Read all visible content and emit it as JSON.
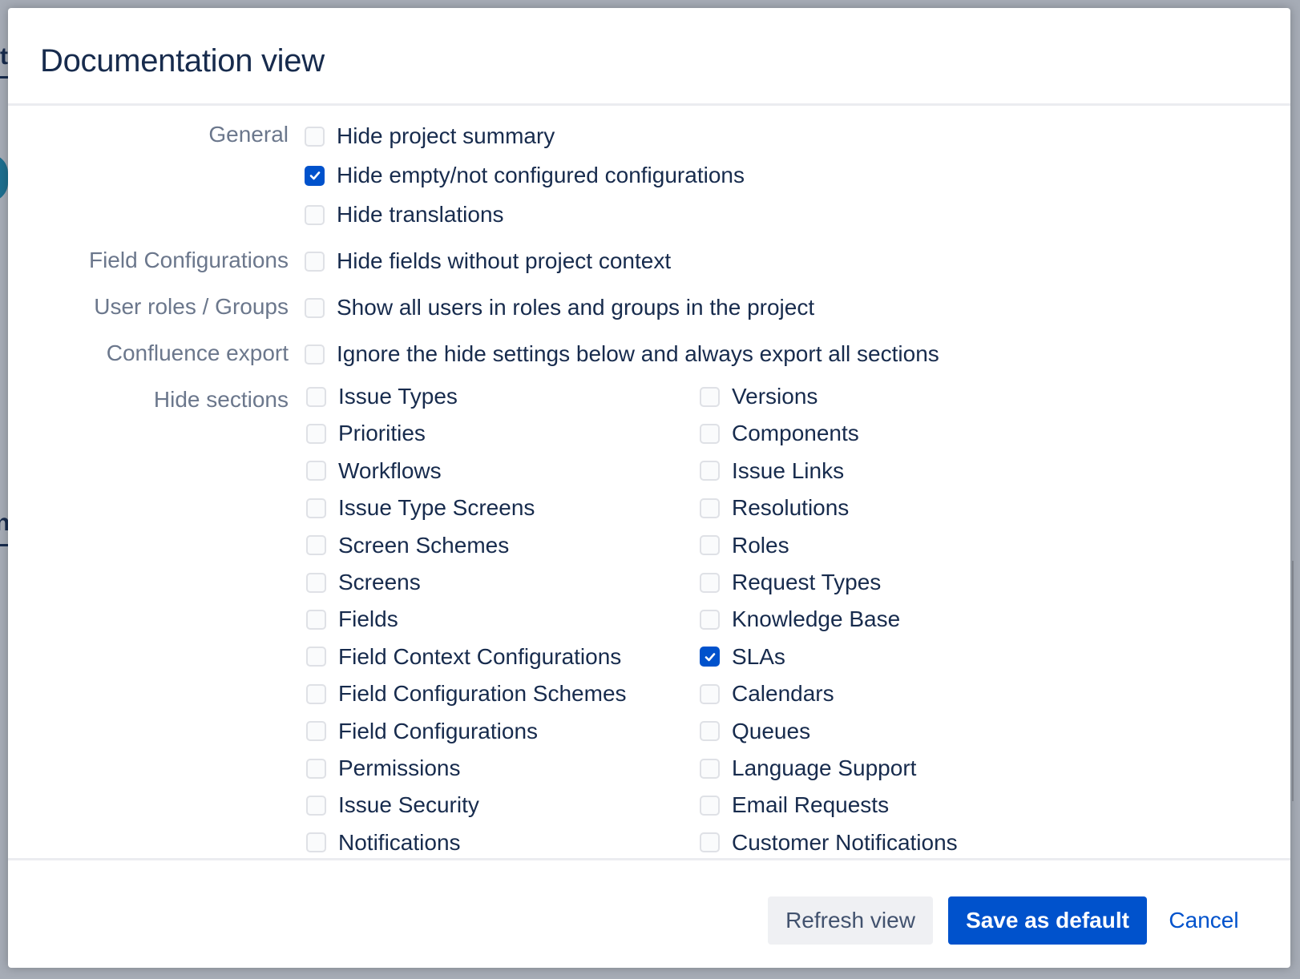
{
  "background": {
    "fragments": [
      "t",
      "n"
    ]
  },
  "dialog": {
    "title": "Documentation view",
    "general": {
      "label": "General",
      "options": [
        {
          "label": "Hide project summary",
          "checked": false
        },
        {
          "label": "Hide empty/not configured configurations",
          "checked": true
        },
        {
          "label": "Hide translations",
          "checked": false
        }
      ]
    },
    "field_configurations": {
      "label": "Field Configurations",
      "option": {
        "label": "Hide fields without project context",
        "checked": false
      }
    },
    "user_roles": {
      "label": "User roles / Groups",
      "option": {
        "label": "Show all users in roles and groups in the project",
        "checked": false
      }
    },
    "confluence_export": {
      "label": "Confluence export",
      "option": {
        "label": "Ignore the hide settings below and always export all sections",
        "checked": false
      }
    },
    "hide_sections": {
      "label": "Hide sections",
      "left": [
        {
          "label": "Issue Types",
          "checked": false
        },
        {
          "label": "Priorities",
          "checked": false
        },
        {
          "label": "Workflows",
          "checked": false
        },
        {
          "label": "Issue Type Screens",
          "checked": false
        },
        {
          "label": "Screen Schemes",
          "checked": false
        },
        {
          "label": "Screens",
          "checked": false
        },
        {
          "label": "Fields",
          "checked": false
        },
        {
          "label": "Field Context Configurations",
          "checked": false
        },
        {
          "label": "Field Configuration Schemes",
          "checked": false
        },
        {
          "label": "Field Configurations",
          "checked": false
        },
        {
          "label": "Permissions",
          "checked": false
        },
        {
          "label": "Issue Security",
          "checked": false
        },
        {
          "label": "Notifications",
          "checked": false
        }
      ],
      "right": [
        {
          "label": "Versions",
          "checked": false
        },
        {
          "label": "Components",
          "checked": false
        },
        {
          "label": "Issue Links",
          "checked": false
        },
        {
          "label": "Resolutions",
          "checked": false
        },
        {
          "label": "Roles",
          "checked": false
        },
        {
          "label": "Request Types",
          "checked": false
        },
        {
          "label": "Knowledge Base",
          "checked": false
        },
        {
          "label": "SLAs",
          "checked": true
        },
        {
          "label": "Calendars",
          "checked": false
        },
        {
          "label": "Queues",
          "checked": false
        },
        {
          "label": "Language Support",
          "checked": false
        },
        {
          "label": "Email Requests",
          "checked": false
        },
        {
          "label": "Customer Notifications",
          "checked": false
        }
      ]
    },
    "footer": {
      "refresh_label": "Refresh view",
      "save_label": "Save as default",
      "cancel_label": "Cancel"
    }
  },
  "colors": {
    "accent": "#0052cc",
    "text": "#172b4d",
    "label": "#6b778c",
    "overlay": "#a6acb6"
  }
}
